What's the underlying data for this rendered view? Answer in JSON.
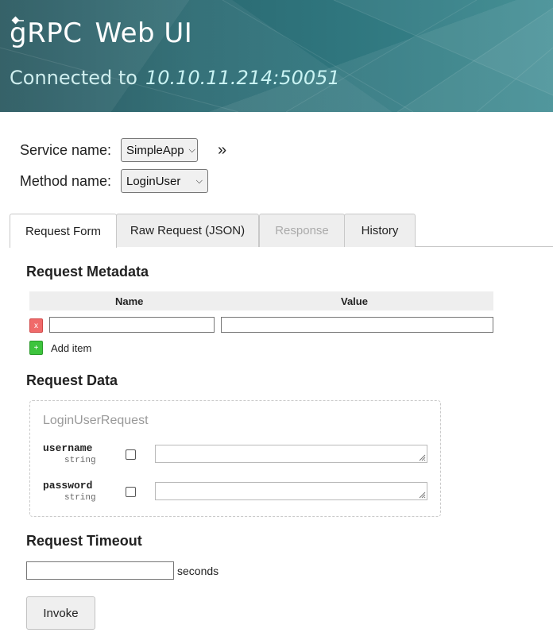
{
  "header": {
    "logo_text": "gRPC",
    "title": "Web UI",
    "connected_label": "Connected to",
    "address": "10.10.11.214:50051"
  },
  "service": {
    "label": "Service name:",
    "value": "SimpleApp"
  },
  "method": {
    "label": "Method name:",
    "value": "LoginUser"
  },
  "tabs": [
    {
      "label": "Request Form",
      "active": true
    },
    {
      "label": "Raw Request (JSON)",
      "active": false
    },
    {
      "label": "Response",
      "disabled": true
    },
    {
      "label": "History",
      "active": false
    }
  ],
  "metadata": {
    "title": "Request Metadata",
    "col_name": "Name",
    "col_value": "Value",
    "delete_label": "x",
    "add_symbol": "+",
    "add_label": "Add item"
  },
  "request_data": {
    "title": "Request Data",
    "message_type": "LoginUserRequest",
    "fields": [
      {
        "name": "username",
        "type": "string"
      },
      {
        "name": "password",
        "type": "string"
      }
    ]
  },
  "timeout": {
    "title": "Request Timeout",
    "unit": "seconds"
  },
  "invoke_label": "Invoke"
}
